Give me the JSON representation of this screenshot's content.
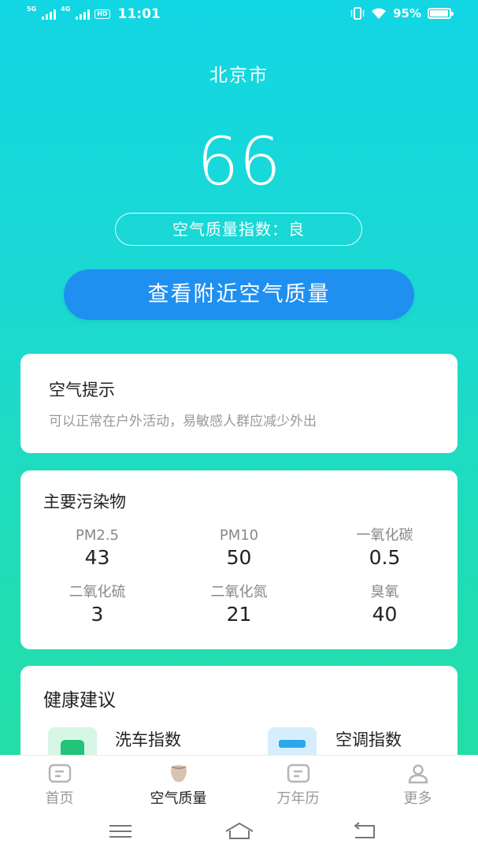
{
  "status_bar": {
    "network1": "5G",
    "network2": "4G",
    "hd": "HD",
    "time": "11:01",
    "battery": "95%",
    "battery_level": 0.95
  },
  "city": "北京市",
  "aqi": {
    "value": "66",
    "label": "空气质量指数：良"
  },
  "nearby_button": "查看附近空气质量",
  "air_tip": {
    "title": "空气提示",
    "text": "可以正常在户外活动，易敏感人群应减少外出"
  },
  "pollutants": {
    "title": "主要污染物",
    "items": [
      {
        "label": "PM2.5",
        "value": "43"
      },
      {
        "label": "PM10",
        "value": "50"
      },
      {
        "label": "一氧化碳",
        "value": "0.5"
      },
      {
        "label": "二氧化硫",
        "value": "3"
      },
      {
        "label": "二氧化氮",
        "value": "21"
      },
      {
        "label": "臭氧",
        "value": "40"
      }
    ]
  },
  "health": {
    "title": "健康建议",
    "items": [
      {
        "label": "洗车指数",
        "icon": "car-wash-icon"
      },
      {
        "label": "空调指数",
        "icon": "air-conditioner-icon"
      }
    ]
  },
  "tabs": [
    {
      "label": "首页",
      "icon": "home-icon",
      "active": false
    },
    {
      "label": "空气质量",
      "icon": "air-quality-icon",
      "active": true
    },
    {
      "label": "万年历",
      "icon": "calendar-icon",
      "active": false
    },
    {
      "label": "更多",
      "icon": "user-icon",
      "active": false
    }
  ],
  "colors": {
    "gradient_top": "#12d6e4",
    "gradient_bottom": "#25df9f",
    "button_blue": "#1f8ff0"
  }
}
